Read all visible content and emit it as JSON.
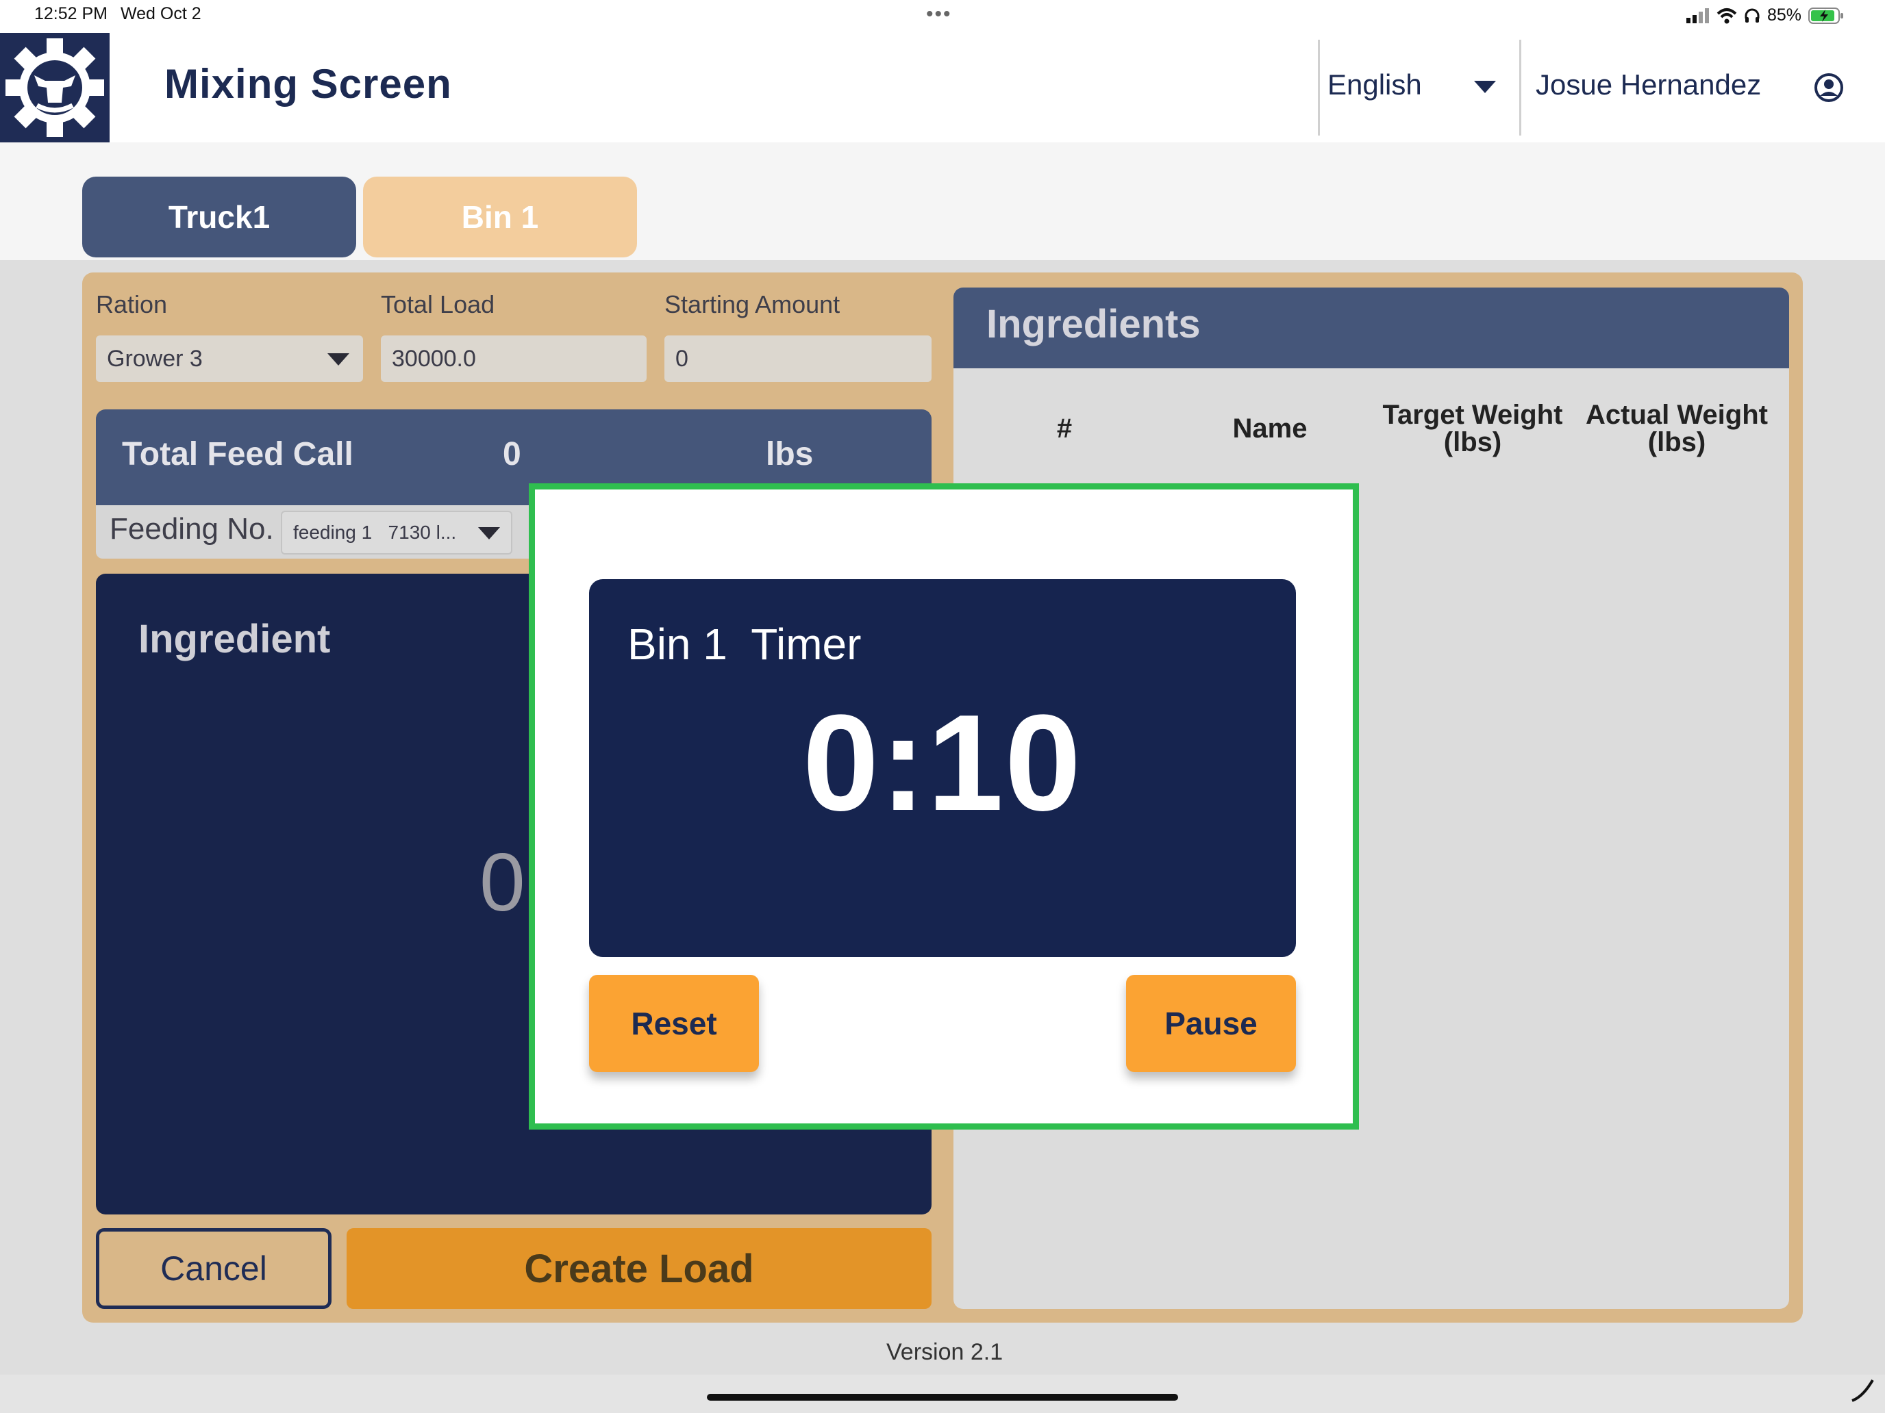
{
  "status_bar": {
    "time": "12:52 PM",
    "date": "Wed Oct 2",
    "battery": "85%"
  },
  "header": {
    "title": "Mixing Screen",
    "language": "English",
    "user": "Josue Hernandez"
  },
  "tabs": [
    {
      "label": "Truck1"
    },
    {
      "label": "Bin 1"
    }
  ],
  "form": {
    "ration": {
      "label": "Ration",
      "value": "Grower 3"
    },
    "total_load": {
      "label": "Total Load",
      "value": "30000.0"
    },
    "starting_amount": {
      "label": "Starting Amount",
      "value": "0"
    }
  },
  "feed_call": {
    "label": "Total Feed Call",
    "value": "0",
    "unit": "lbs"
  },
  "feeding": {
    "label": "Feeding No.",
    "selected": "feeding 1   7130 l..."
  },
  "ingredient_panel": {
    "title": "Ingredient",
    "partial_value": "0"
  },
  "buttons": {
    "cancel": "Cancel",
    "create_load": "Create Load"
  },
  "ingredients_table": {
    "title": "Ingredients",
    "columns": [
      "#",
      "Name",
      "Target Weight (lbs)",
      "Actual Weight (lbs)"
    ]
  },
  "modal": {
    "timer_label": "Bin 1  Timer",
    "timer_value": "0:10",
    "reset_label": "Reset",
    "pause_label": "Pause"
  },
  "footer": {
    "version": "Version 2.1"
  },
  "colors": {
    "navy": "#16244f",
    "accent_orange": "#fba333",
    "highlight_green": "#2fbe4f",
    "tan": "#d9b788"
  }
}
